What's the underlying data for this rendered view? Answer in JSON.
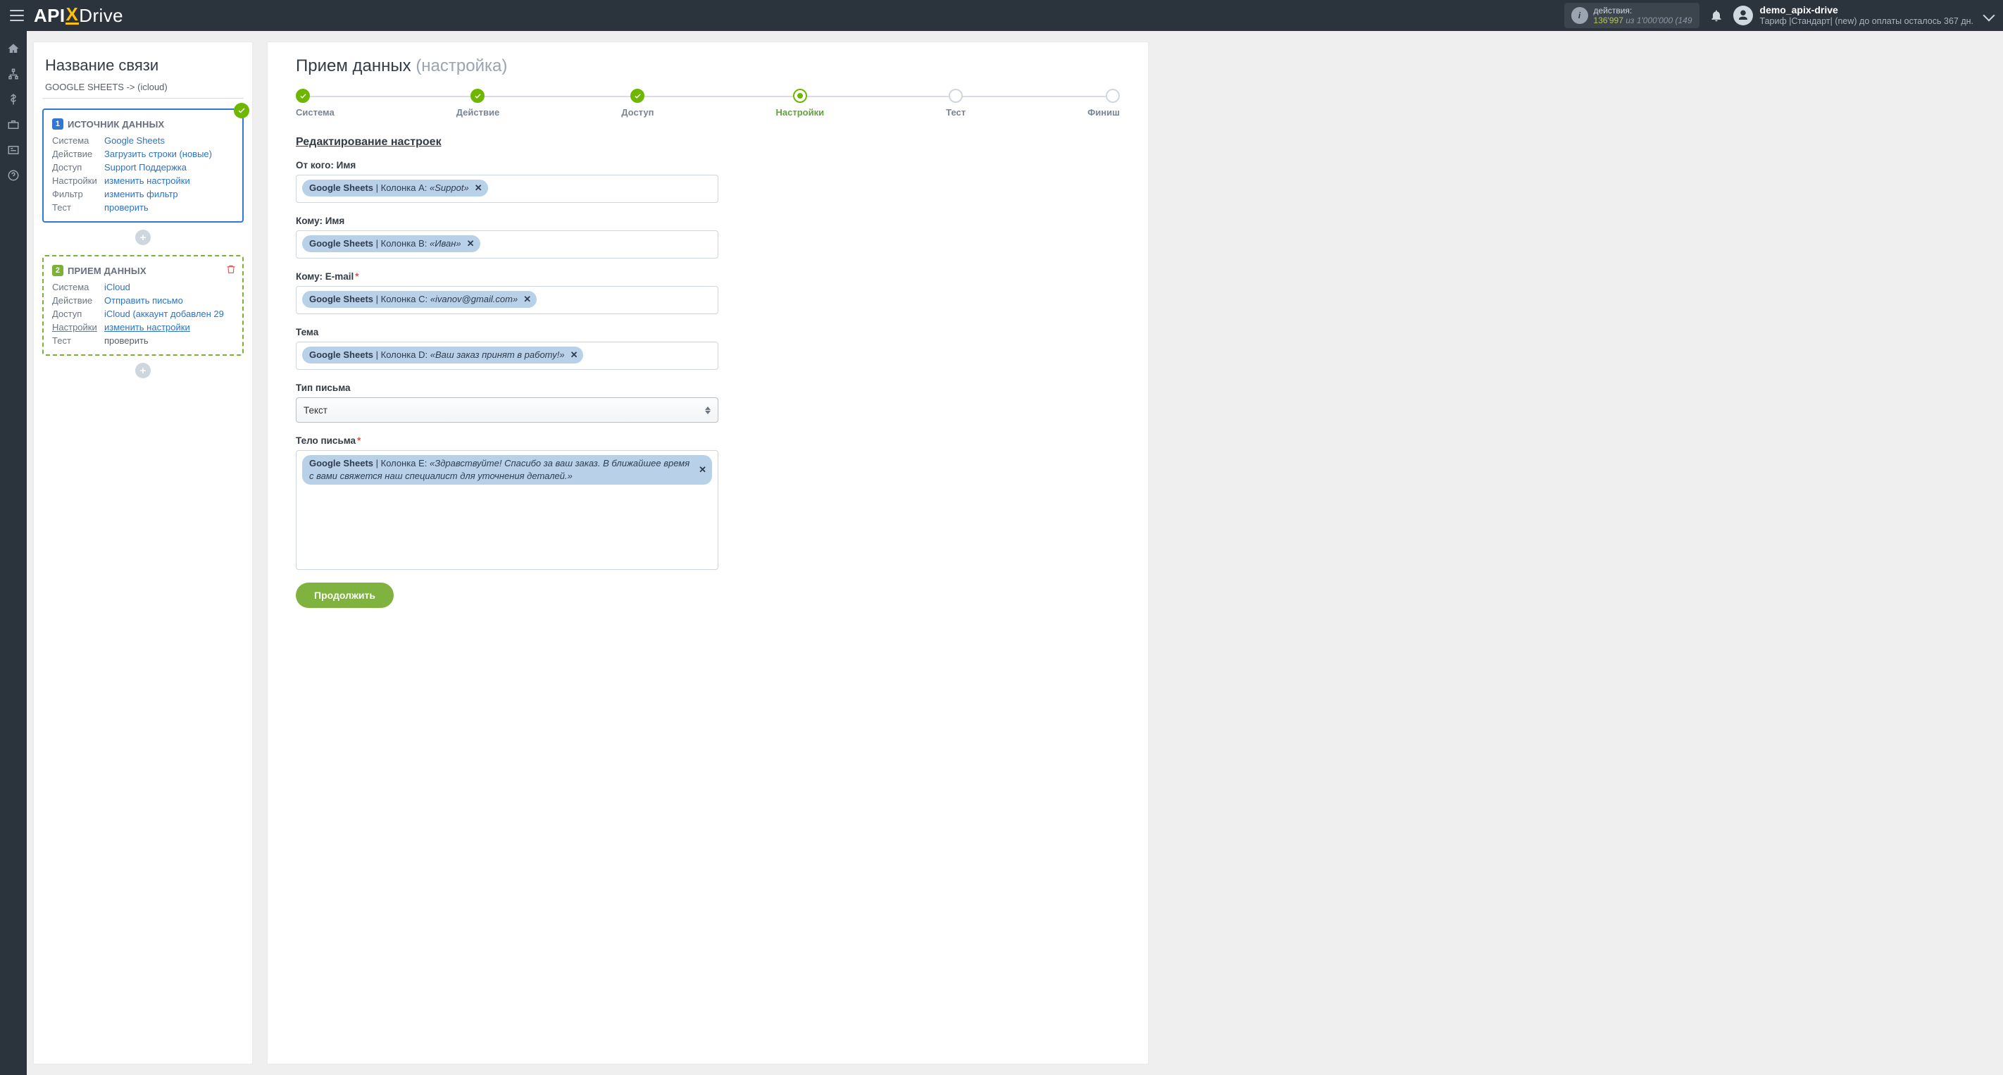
{
  "header": {
    "logo_prefix": "API",
    "logo_x": "X",
    "logo_suffix": "Drive",
    "actions_label": "действия:",
    "actions_used": "136'997",
    "actions_of": "из",
    "actions_total": "1'000'000",
    "actions_tail": "(149",
    "user_name": "demo_apix-drive",
    "user_sub": "Тариф |Стандарт| (new) до оплаты осталось 367 дн."
  },
  "sidebar": {
    "title": "Название связи",
    "path": "GOOGLE SHEETS -> (icloud)",
    "source": {
      "num": "1",
      "title": "ИСТОЧНИК ДАННЫХ",
      "rows": [
        {
          "k": "Система",
          "v": "Google Sheets"
        },
        {
          "k": "Действие",
          "v": "Загрузить строки (новые)"
        },
        {
          "k": "Доступ",
          "v": "Support Поддержка"
        },
        {
          "k": "Настройки",
          "v": "изменить настройки"
        },
        {
          "k": "Фильтр",
          "v": "изменить фильтр"
        },
        {
          "k": "Тест",
          "v": "проверить"
        }
      ]
    },
    "dest": {
      "num": "2",
      "title": "ПРИЕМ ДАННЫХ",
      "rows": [
        {
          "k": "Система",
          "v": "iCloud"
        },
        {
          "k": "Действие",
          "v": "Отправить письмо"
        },
        {
          "k": "Доступ",
          "v": "iCloud (аккаунт добавлен 29"
        },
        {
          "k": "Настройки",
          "v": "изменить настройки",
          "k_underline": true,
          "v_underline": true
        },
        {
          "k": "Тест",
          "v": "проверить",
          "plain": true
        }
      ]
    }
  },
  "main": {
    "title_a": "Прием данных",
    "title_b": "(настройка)",
    "steps": [
      "Система",
      "Действие",
      "Доступ",
      "Настройки",
      "Тест",
      "Финиш"
    ],
    "section_title": "Редактирование настроек",
    "fields": {
      "from": {
        "label": "От кого: Имя",
        "chip_source": "Google Sheets",
        "chip_sep": " | ",
        "chip_col": "Колонка A: ",
        "chip_val": "«Suppot»"
      },
      "to_name": {
        "label": "Кому: Имя",
        "chip_source": "Google Sheets",
        "chip_col": "Колонка B: ",
        "chip_val": "«Иван»"
      },
      "to_email": {
        "label": "Кому: E-mail",
        "chip_source": "Google Sheets",
        "chip_col": "Колонка C: ",
        "chip_val": "«ivanov@gmail.com»"
      },
      "subject": {
        "label": "Тема",
        "chip_source": "Google Sheets",
        "chip_col": "Колонка D: ",
        "chip_val": "«Ваш заказ принят в работу!»"
      },
      "type": {
        "label": "Тип письма",
        "value": "Текст"
      },
      "body": {
        "label": "Тело письма",
        "chip_source": "Google Sheets",
        "chip_col": "Колонка E: ",
        "chip_val": "«Здравствуйте! Спасибо за ваш заказ. В ближайшее время с вами свяжется наш специалист для уточнения деталей.»"
      }
    },
    "continue": "Продолжить"
  }
}
